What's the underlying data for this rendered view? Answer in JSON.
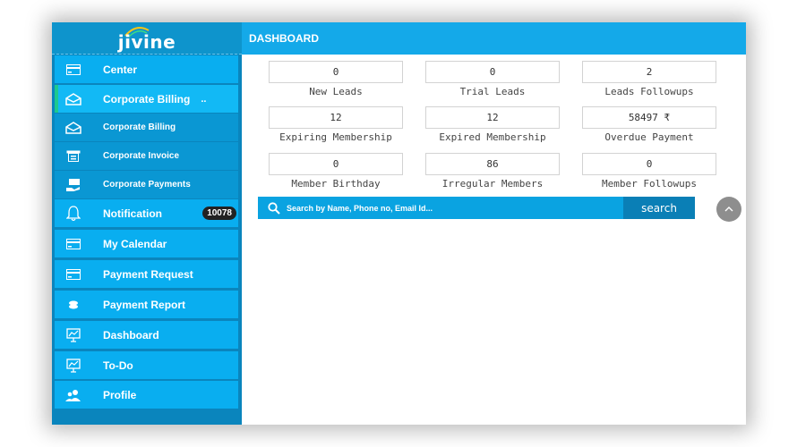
{
  "app": {
    "logo_text": "jivine"
  },
  "header": {
    "title": "DASHBOARD"
  },
  "sidebar": {
    "items": [
      {
        "label": "Center"
      },
      {
        "label": "Corporate Billing",
        "caret": ".."
      },
      {
        "label": "Corporate Billing"
      },
      {
        "label": "Corporate Invoice"
      },
      {
        "label": "Corporate Payments"
      },
      {
        "label": "Notification",
        "badge": "10078"
      },
      {
        "label": "My Calendar"
      },
      {
        "label": "Payment Request"
      },
      {
        "label": "Payment Report"
      },
      {
        "label": "Dashboard"
      },
      {
        "label": "To-Do"
      },
      {
        "label": "Profile"
      }
    ]
  },
  "stats": [
    {
      "value": "0",
      "label": "New Leads"
    },
    {
      "value": "0",
      "label": "Trial Leads"
    },
    {
      "value": "2",
      "label": "Leads Followups"
    },
    {
      "value": "12",
      "label": "Expiring Membership"
    },
    {
      "value": "12",
      "label": "Expired Membership"
    },
    {
      "value": "58497 ₹",
      "label": "Overdue Payment"
    },
    {
      "value": "0",
      "label": "Member Birthday"
    },
    {
      "value": "86",
      "label": "Irregular Members"
    },
    {
      "value": "0",
      "label": "Member Followups"
    }
  ],
  "search": {
    "placeholder": "Search by Name, Phone no, Email Id...",
    "button_label": "search"
  },
  "colors": {
    "sidebar_bg": "#0a85bd",
    "menu_item_bg": "#09aef0",
    "header_bg": "#14a9e9",
    "active_marker": "#1ec98e"
  }
}
